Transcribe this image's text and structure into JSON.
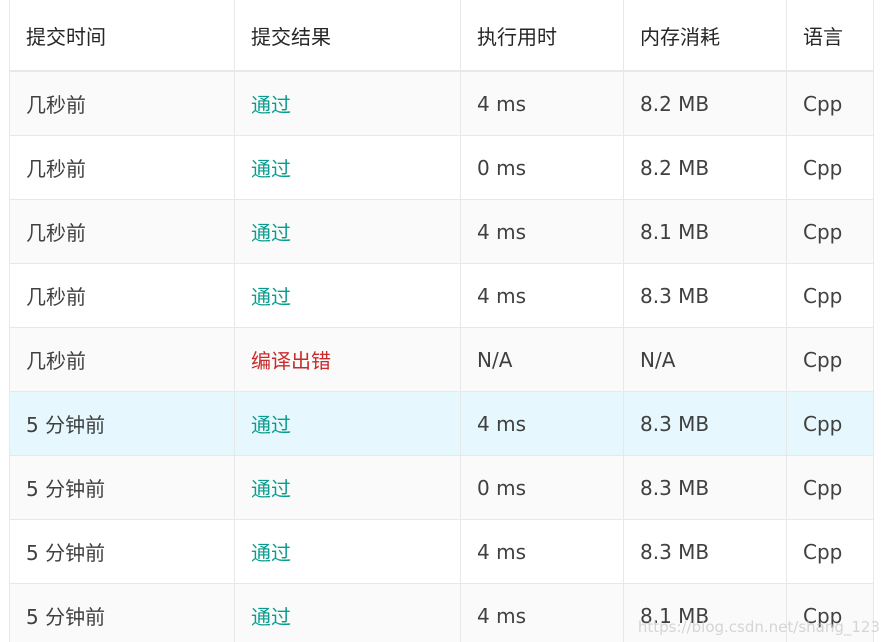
{
  "headers": [
    "提交时间",
    "提交结果",
    "执行用时",
    "内存消耗",
    "语言"
  ],
  "rows": [
    {
      "time": "几秒前",
      "result": "通过",
      "status": "pass",
      "runtime": "4 ms",
      "memory": "8.2 MB",
      "language": "Cpp"
    },
    {
      "time": "几秒前",
      "result": "通过",
      "status": "pass",
      "runtime": "0 ms",
      "memory": "8.2 MB",
      "language": "Cpp"
    },
    {
      "time": "几秒前",
      "result": "通过",
      "status": "pass",
      "runtime": "4 ms",
      "memory": "8.1 MB",
      "language": "Cpp"
    },
    {
      "time": "几秒前",
      "result": "通过",
      "status": "pass",
      "runtime": "4 ms",
      "memory": "8.3 MB",
      "language": "Cpp"
    },
    {
      "time": "几秒前",
      "result": "编译出错",
      "status": "fail",
      "runtime": "N/A",
      "memory": "N/A",
      "language": "Cpp"
    },
    {
      "time": "5 分钟前",
      "result": "通过",
      "status": "pass",
      "runtime": "4 ms",
      "memory": "8.3 MB",
      "language": "Cpp",
      "highlight": true
    },
    {
      "time": "5 分钟前",
      "result": "通过",
      "status": "pass",
      "runtime": "0 ms",
      "memory": "8.3 MB",
      "language": "Cpp"
    },
    {
      "time": "5 分钟前",
      "result": "通过",
      "status": "pass",
      "runtime": "4 ms",
      "memory": "8.3 MB",
      "language": "Cpp"
    },
    {
      "time": "5 分钟前",
      "result": "通过",
      "status": "pass",
      "runtime": "4 ms",
      "memory": "8.1 MB",
      "language": "Cpp"
    }
  ],
  "colors": {
    "pass": "#0a9d8f",
    "fail": "#c92b2b",
    "highlight_row": "#e6f7fd"
  },
  "watermark": "https://blog.csdn.net/shang_123"
}
